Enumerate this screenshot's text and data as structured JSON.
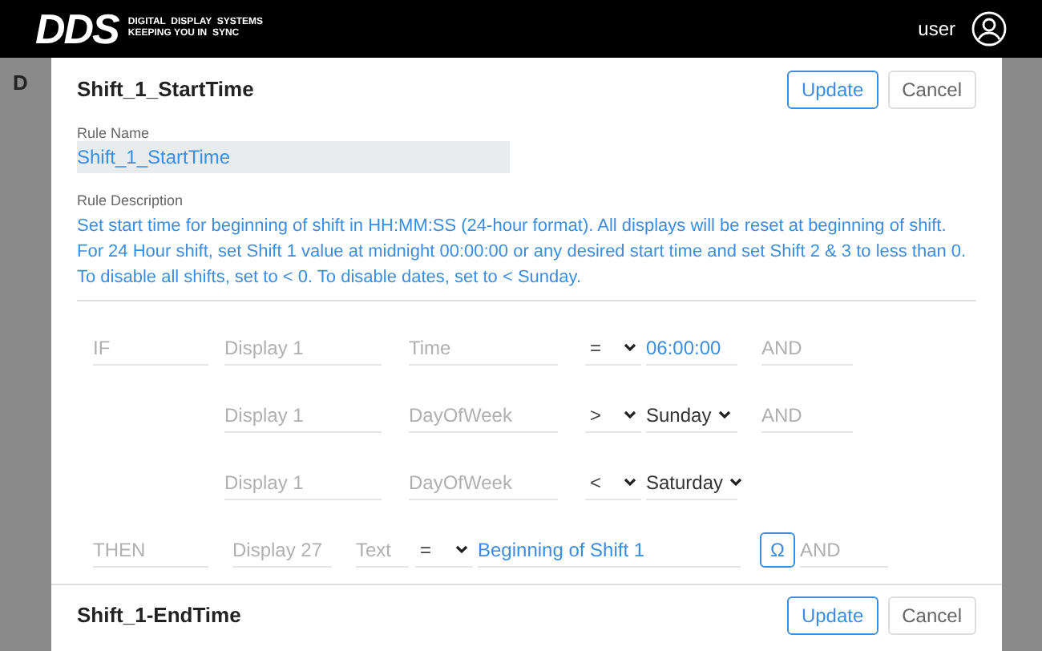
{
  "header": {
    "logo": "DDS",
    "tagline": [
      "DIGITAL  DISPLAY  SYSTEMS",
      "KEEPING YOU IN  SYNC"
    ],
    "user": "user"
  },
  "backdrop_text": "D",
  "rule": {
    "title": "Shift_1_StartTime",
    "buttons": [
      {
        "label": "Update",
        "kind": "primary"
      },
      {
        "label": "Cancel",
        "kind": "secondary"
      }
    ],
    "name_label": "Rule Name",
    "name_value": "Shift_1_StartTime",
    "description_label": "Rule Description",
    "description": "Set start time for beginning of shift in HH:MM:SS (24-hour format). All displays will be reset at beginning of shift. For 24 Hour shift, set Shift 1 value at midnight 00:00:00 or any desired start time and set Shift 2 & 3 to less than 0. To disable all shifts, set to < 0. To disable dates, set to < Sunday.",
    "rows": [
      {
        "cells": [
          {
            "kind": "label",
            "text": "IF"
          },
          {
            "kind": "label",
            "text": "Display 1"
          },
          {
            "kind": "label",
            "text": "Time"
          },
          {
            "kind": "op",
            "text": "="
          },
          {
            "kind": "value",
            "text": "06:00:00"
          },
          {
            "kind": "label",
            "text": "AND"
          }
        ]
      },
      {
        "cells": [
          {
            "kind": "blank"
          },
          {
            "kind": "label",
            "text": "Display 1"
          },
          {
            "kind": "label",
            "text": "DayOfWeek"
          },
          {
            "kind": "op",
            "text": ">"
          },
          {
            "kind": "choice",
            "text": "Sunday"
          },
          {
            "kind": "label",
            "text": "AND"
          }
        ]
      },
      {
        "cells": [
          {
            "kind": "blank"
          },
          {
            "kind": "label",
            "text": "Display 1"
          },
          {
            "kind": "label",
            "text": "DayOfWeek"
          },
          {
            "kind": "op",
            "text": "<"
          },
          {
            "kind": "choice",
            "text": "Saturday"
          }
        ]
      }
    ],
    "action": {
      "cells": [
        {
          "kind": "label",
          "text": "THEN"
        },
        {
          "kind": "label",
          "text": "Display 27"
        },
        {
          "kind": "label",
          "text": "Text"
        },
        {
          "kind": "op",
          "text": "="
        },
        {
          "kind": "value",
          "text": "Beginning of Shift 1"
        },
        {
          "kind": "symbol",
          "text": "Ω"
        },
        {
          "kind": "label",
          "text": "AND"
        }
      ]
    }
  },
  "next_rule": {
    "title": "Shift_1-EndTime",
    "buttons": [
      {
        "label": "Update",
        "kind": "primary"
      },
      {
        "label": "Cancel",
        "kind": "secondary"
      }
    ]
  }
}
